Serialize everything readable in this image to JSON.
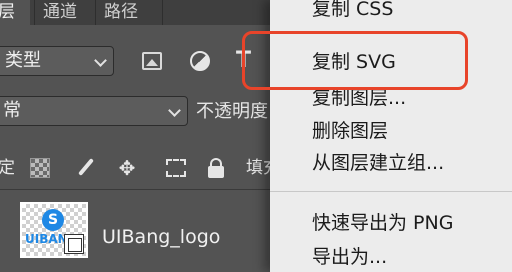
{
  "panel": {
    "tabs": [
      "层",
      "通道",
      "路径"
    ],
    "filter": {
      "value": "类型"
    },
    "blend_mode": {
      "value": "常"
    },
    "opacity_label": "不透明度",
    "lock_label": "定:",
    "fill_label": "填充",
    "layer": {
      "name": "UIBang_logo",
      "thumb_text": "UIBAN"
    }
  },
  "context_menu": {
    "items": [
      "复制 CSS",
      "复制 SVG",
      "复制图层...",
      "删除图层",
      "从图层建立组...",
      "快速导出为 PNG",
      "导出为..."
    ]
  },
  "colors": {
    "panel_bg": "#535353",
    "menu_bg": "#ececec",
    "highlight": "#e8442a",
    "logo_blue": "#1e88e5"
  }
}
